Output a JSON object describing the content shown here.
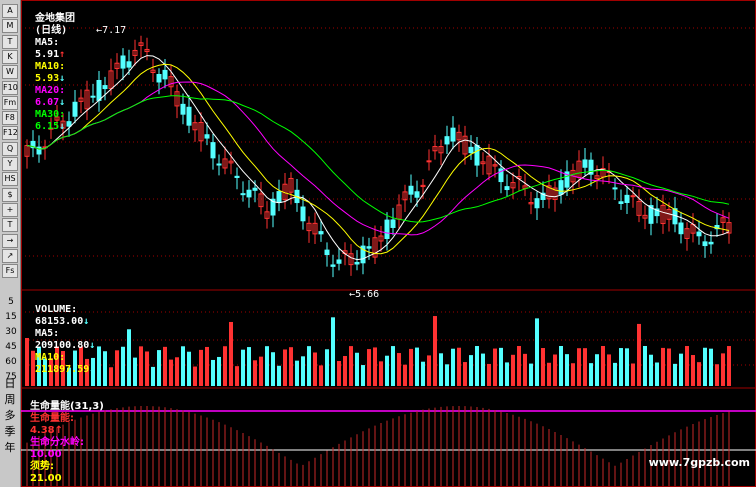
{
  "toolbar": {
    "buttons": [
      "A",
      "M",
      "T",
      "K",
      "W",
      "F10",
      "Fm",
      "F8",
      "F12",
      "Q",
      "Y",
      "HS",
      "$",
      "+",
      "T",
      "→",
      "↗",
      "Fs"
    ],
    "periods": [
      "日",
      "周",
      "多",
      "季",
      "年"
    ]
  },
  "price_panel": {
    "stock": "金地集团",
    "period": "(日线)",
    "ma5_label": "MA5:",
    "ma5_value": "5.91",
    "ma5_arrow": "↑",
    "ma10_label": "MA10:",
    "ma10_value": "5.93",
    "ma10_arrow": "↓",
    "ma20_label": "MA20:",
    "ma20_value": "6.07",
    "ma20_arrow": "↓",
    "ma30_label": "MA30:",
    "ma30_value": "6.15",
    "ma30_arrow": "↓",
    "high_note": "7.17",
    "low_note": "5.66"
  },
  "volume_panel": {
    "label": "VOLUME:",
    "value": "68153.00",
    "value_arrow": "↓",
    "ma5_label": "MA5:",
    "ma5_value": "209100.80",
    "ma5_arrow": "↓",
    "ma10_label": "MA10:",
    "ma10_value": "211897.59",
    "ma10_arrow": "↓",
    "scale": [
      "5",
      "15",
      "30",
      "45",
      "60",
      "75"
    ]
  },
  "indicator_panel": {
    "name": "生命量能",
    "params": "(31,3)",
    "energy_label": "生命量能:",
    "energy_value": "4.38",
    "energy_arrow": "↑",
    "watershed_label": "生命分水岭:",
    "watershed_value": "10.00",
    "trend_label": "须势:",
    "trend_value": "21.00"
  },
  "watermark": "www.7gpzb.com",
  "colors": {
    "up": "#ff3232",
    "down": "#54ffff",
    "ma5": "#ffffff",
    "ma10": "#ffff00",
    "ma20": "#ff00ff",
    "ma30": "#00ff00",
    "grid": "#a00000"
  }
}
